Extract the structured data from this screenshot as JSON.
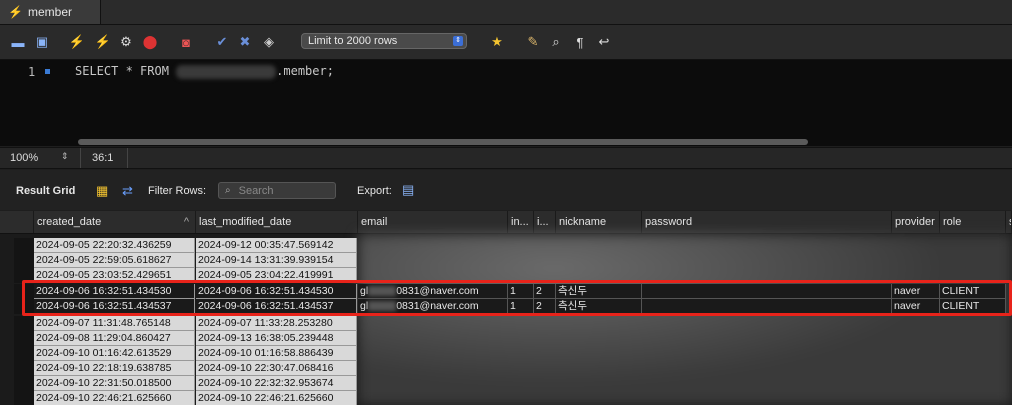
{
  "tab": {
    "label": "member"
  },
  "toolbar": {
    "limit_label": "Limit to 2000 rows"
  },
  "editor": {
    "line_number": "1",
    "code_before": "SELECT * FROM ",
    "code_after": ".member;"
  },
  "status": {
    "zoom": "100%",
    "position": "36:1"
  },
  "result": {
    "grid_label": "Result Grid",
    "filter_label": "Filter Rows:",
    "search_placeholder": "Search",
    "export_label": "Export:"
  },
  "columns": [
    "created_date",
    "last_modified_date",
    "email",
    "in...",
    "i...",
    "nickname",
    "password",
    "provider",
    "role",
    "s"
  ],
  "rows": [
    {
      "created_date": "2024-09-05 22:20:32.436259",
      "last_modified_date": "2024-09-12 00:35:47.569142"
    },
    {
      "created_date": "2024-09-05 22:59:05.618627",
      "last_modified_date": "2024-09-14 13:31:39.939154"
    },
    {
      "created_date": "2024-09-05 23:03:52.429651",
      "last_modified_date": "2024-09-05 23:04:22.419991"
    },
    {
      "created_date": "2024-09-06 16:32:51.434530",
      "last_modified_date": "2024-09-06 16:32:51.434530",
      "email_prefix": "gl",
      "email_suffix": "0831@naver.com",
      "in": "1",
      "i": "2",
      "nickname": "측신두",
      "provider": "naver",
      "role": "CLIENT"
    },
    {
      "created_date": "2024-09-06 16:32:51.434537",
      "last_modified_date": "2024-09-06 16:32:51.434537",
      "email_prefix": "gl",
      "email_suffix": "0831@naver.com",
      "in": "1",
      "i": "2",
      "nickname": "측신두",
      "provider": "naver",
      "role": "CLIENT"
    },
    {
      "created_date": "2024-09-07 11:31:48.765148",
      "last_modified_date": "2024-09-07 11:33:28.253280"
    },
    {
      "created_date": "2024-09-08 11:29:04.860427",
      "last_modified_date": "2024-09-13 16:38:05.239448"
    },
    {
      "created_date": "2024-09-10 01:16:42.613529",
      "last_modified_date": "2024-09-10 01:16:58.886439"
    },
    {
      "created_date": "2024-09-10 22:18:19.638785",
      "last_modified_date": "2024-09-10 22:30:47.068416"
    },
    {
      "created_date": "2024-09-10 22:31:50.018500",
      "last_modified_date": "2024-09-10 22:32:32.953674"
    },
    {
      "created_date": "2024-09-10 22:46:21.625660",
      "last_modified_date": "2024-09-10 22:46:21.625660"
    }
  ],
  "colors": {
    "highlight": "#e8231a",
    "accent": "#3a7bd5"
  },
  "icons": [
    "folder-icon",
    "save-icon",
    "execute-icon",
    "execute-selection-icon",
    "explain-icon",
    "stop-icon",
    "toggle-icon",
    "commit-icon",
    "rollback-icon",
    "autocommit-icon",
    "favorite-icon",
    "beautify-icon",
    "find-icon",
    "invisibles-icon",
    "wrap-icon",
    "form-icon",
    "export-icon"
  ]
}
